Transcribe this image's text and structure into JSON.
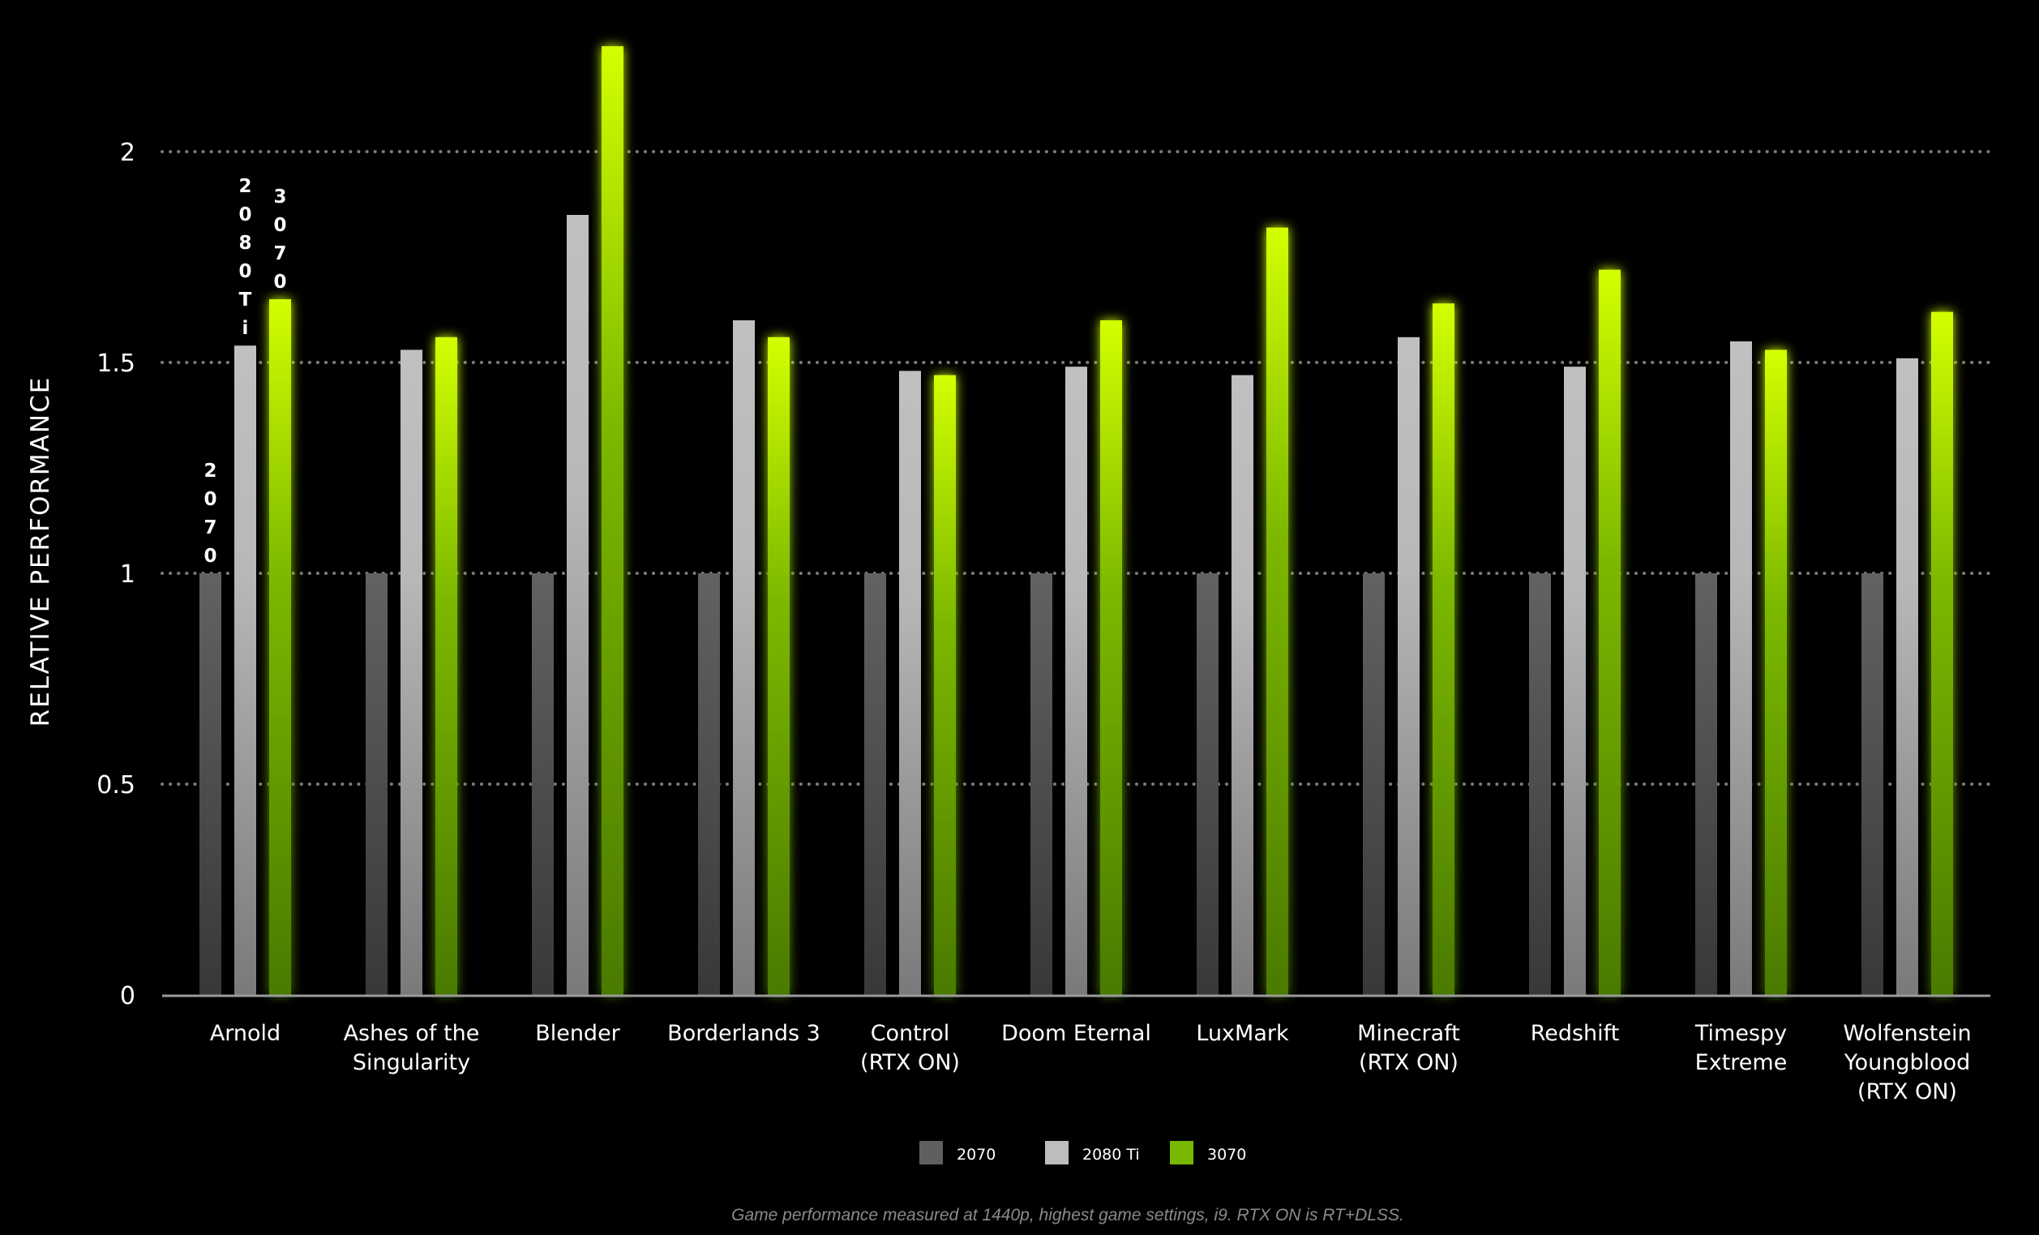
{
  "chart_data": {
    "type": "bar",
    "title": "",
    "xlabel": "",
    "ylabel": "RELATIVE  PERFORMANCE",
    "ylim": [
      0,
      2.25
    ],
    "yticks": [
      0,
      0.5,
      1,
      1.5,
      2
    ],
    "ytick_labels": [
      "0",
      "0.5",
      "1",
      "1.5",
      "2"
    ],
    "grid": true,
    "categories": [
      [
        "Arnold"
      ],
      [
        "Ashes of the",
        "Singularity"
      ],
      [
        "Blender"
      ],
      [
        "Borderlands 3"
      ],
      [
        "Control",
        "(RTX ON)"
      ],
      [
        "Doom Eternal"
      ],
      [
        "LuxMark"
      ],
      [
        "Minecraft",
        "(RTX ON)"
      ],
      [
        "Redshift"
      ],
      [
        "Timespy",
        "Extreme"
      ],
      [
        "Wolfenstein",
        "Youngblood",
        "(RTX ON)"
      ]
    ],
    "series": [
      {
        "name": "2070",
        "color": "#5f5f5f",
        "values": [
          1,
          1,
          1,
          1,
          1,
          1,
          1,
          1,
          1,
          1,
          1
        ]
      },
      {
        "name": "2080 Ti",
        "color": "#bdbdbd",
        "values": [
          1.54,
          1.53,
          1.85,
          1.6,
          1.48,
          1.49,
          1.47,
          1.56,
          1.49,
          1.55,
          1.51
        ]
      },
      {
        "name": "3070",
        "color": "#76b900",
        "values": [
          1.65,
          1.56,
          2.25,
          1.56,
          1.47,
          1.6,
          1.82,
          1.64,
          1.72,
          1.53,
          1.62
        ]
      }
    ],
    "bar_annotations": [
      {
        "category_index": 0,
        "series_index": 0,
        "text": "2070"
      },
      {
        "category_index": 0,
        "series_index": 1,
        "text": "2080Ti"
      },
      {
        "category_index": 0,
        "series_index": 2,
        "text": "3070"
      }
    ],
    "legend": {
      "placement": "bottom-center",
      "entries": [
        "2070",
        "2080 Ti",
        "3070"
      ]
    },
    "footnote": "Game performance measured at 1440p, highest game settings, i9. RTX ON is RT+DLSS."
  }
}
